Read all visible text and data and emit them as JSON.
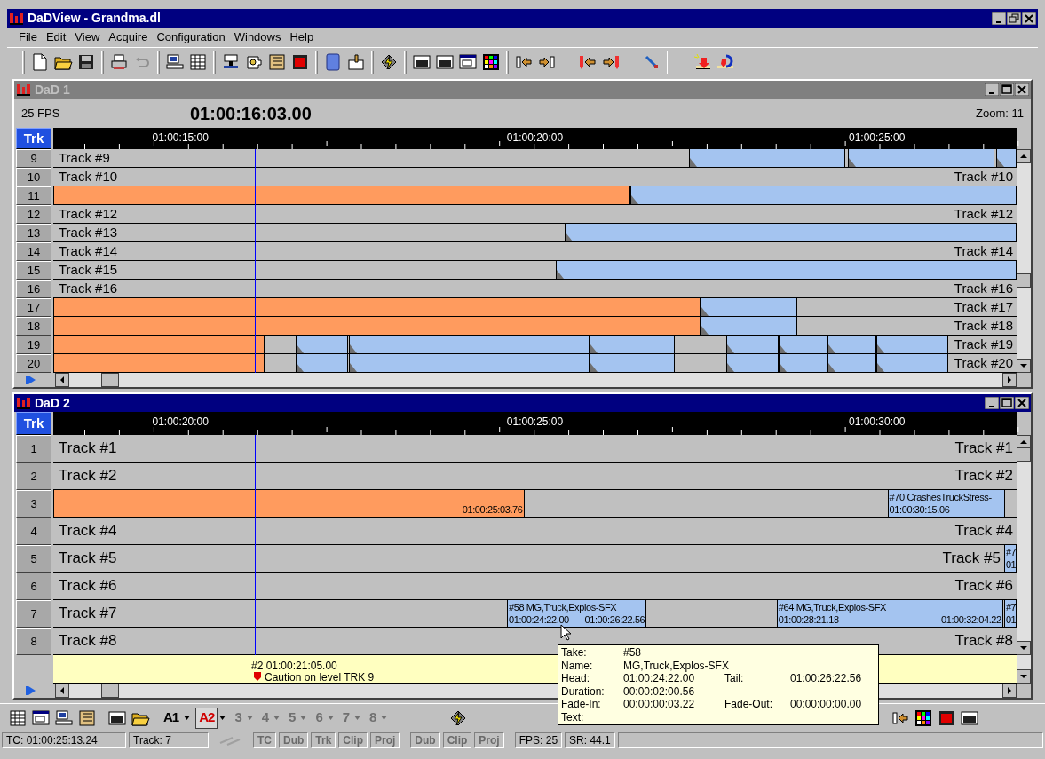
{
  "window": {
    "title": "DaDView - Grandma.dl"
  },
  "menu": [
    "File",
    "Edit",
    "View",
    "Acquire",
    "Configuration",
    "Windows",
    "Help"
  ],
  "panels": [
    {
      "title": "DaD 1",
      "active": false,
      "fps": "25 FPS",
      "timecode": "01:00:16:03.00",
      "zoom": "Zoom: 11",
      "trk": "Trk",
      "ruler": [
        "01:00:15:00",
        "01:00:20:00",
        "01:00:25:00"
      ],
      "tracks": [
        {
          "number": "9",
          "left": "Track #9",
          "clips": [
            {
              "kind": "take"
            },
            {
              "kind": "take"
            },
            {
              "kind": "take"
            }
          ]
        },
        {
          "number": "10",
          "left": "Track #10",
          "right": "Track #10"
        },
        {
          "number": "11",
          "clips": [
            {
              "kind": "region"
            },
            {
              "kind": "take"
            }
          ]
        },
        {
          "number": "12",
          "left": "Track #12",
          "right": "Track #12"
        },
        {
          "number": "13",
          "left": "Track #13",
          "clips": [
            {
              "kind": "take"
            }
          ]
        },
        {
          "number": "14",
          "left": "Track #14",
          "right": "Track #14"
        },
        {
          "number": "15",
          "left": "Track #15",
          "clips": [
            {
              "kind": "take"
            }
          ]
        },
        {
          "number": "16",
          "left": "Track #16",
          "right": "Track #16"
        },
        {
          "number": "17",
          "right": "Track #17",
          "clips": [
            {
              "kind": "region"
            },
            {
              "kind": "take"
            }
          ]
        },
        {
          "number": "18",
          "right": "Track #18",
          "clips": [
            {
              "kind": "region"
            },
            {
              "kind": "take"
            }
          ]
        },
        {
          "number": "19",
          "right": "Track #19",
          "clips": [
            {
              "kind": "region"
            },
            {
              "kind": "take"
            },
            {
              "kind": "take"
            },
            {
              "kind": "take"
            },
            {
              "kind": "take"
            },
            {
              "kind": "take"
            },
            {
              "kind": "take"
            },
            {
              "kind": "take"
            }
          ]
        },
        {
          "number": "20",
          "right": "Track #20",
          "clips": [
            {
              "kind": "region"
            },
            {
              "kind": "take"
            },
            {
              "kind": "take"
            },
            {
              "kind": "take"
            },
            {
              "kind": "take"
            },
            {
              "kind": "take"
            },
            {
              "kind": "take"
            },
            {
              "kind": "take"
            }
          ]
        }
      ]
    },
    {
      "title": "DaD 2",
      "active": true,
      "trk": "Trk",
      "ruler": [
        "01:00:20:00",
        "01:00:25:00",
        "01:00:30:00"
      ],
      "tracks": [
        {
          "number": "1",
          "left": "Track #1",
          "right": "Track #1"
        },
        {
          "number": "2",
          "left": "Track #2",
          "right": "Track #2"
        },
        {
          "number": "3",
          "clips": [
            {
              "kind": "region",
              "tail": "01:00:25:03.76"
            },
            {
              "kind": "take",
              "title": "#70 CrashesTruckStress-",
              "head": "01:00:30:15.06"
            }
          ]
        },
        {
          "number": "4",
          "left": "Track #4",
          "right": "Track #4"
        },
        {
          "number": "5",
          "left": "Track #5",
          "right": "Track #5",
          "clips": [
            {
              "kind": "take",
              "title": "#7",
              "head": "01"
            }
          ]
        },
        {
          "number": "6",
          "left": "Track #6",
          "right": "Track #6"
        },
        {
          "number": "7",
          "left": "Track #7",
          "clips": [
            {
              "kind": "take",
              "title": "#58 MG,Truck,Explos-SFX",
              "head": "01:00:24:22.00",
              "tail": "01:00:26:22.56"
            },
            {
              "kind": "take",
              "title": "#64 MG,Truck,Explos-SFX",
              "head": "01:00:28:21.18",
              "tail": "01:00:32:04.22"
            },
            {
              "kind": "take",
              "title": "#7",
              "head": "01"
            }
          ]
        },
        {
          "number": "8",
          "left": "Track #8",
          "right": "Track #8"
        }
      ],
      "marker": {
        "title": "#2 01:00:21:05.00",
        "note": "Caution on level TRK 9"
      }
    }
  ],
  "tooltip": [
    {
      "label": "Take:",
      "value": "#58"
    },
    {
      "label": "Name:",
      "value": "MG,Truck,Explos-SFX"
    },
    {
      "label": "Head:",
      "value": "01:00:24:22.00",
      "label2": "Tail:",
      "value2": "01:00:26:22.56"
    },
    {
      "label": "Duration:",
      "value": "00:00:02:00.56"
    },
    {
      "label": "Fade-In:",
      "value": "00:00:00:03.22",
      "label2": "Fade-Out:",
      "value2": "00:00:00:00.00"
    },
    {
      "label": "Text:"
    }
  ],
  "layer_buttons": [
    {
      "label": "A1",
      "selected": false,
      "disabled": false
    },
    {
      "label": "A2",
      "selected": true,
      "disabled": false
    },
    {
      "label": "3",
      "selected": false,
      "disabled": true
    },
    {
      "label": "4",
      "selected": false,
      "disabled": true
    },
    {
      "label": "5",
      "selected": false,
      "disabled": true
    },
    {
      "label": "6",
      "selected": false,
      "disabled": true
    },
    {
      "label": "7",
      "selected": false,
      "disabled": true
    },
    {
      "label": "8",
      "selected": false,
      "disabled": true
    }
  ],
  "status_bar": [
    {
      "text": "TC: 01:00:25:13.24",
      "disabled": false
    },
    {
      "text": "Track: 7",
      "disabled": false
    },
    {
      "text": "TC",
      "disabled": true
    },
    {
      "text": "Dub",
      "disabled": true
    },
    {
      "text": "Trk",
      "disabled": true
    },
    {
      "text": "Clip",
      "disabled": true
    },
    {
      "text": "Proj",
      "disabled": true
    },
    {
      "text": "Dub",
      "disabled": true
    },
    {
      "text": "Clip",
      "disabled": true
    },
    {
      "text": "Proj",
      "disabled": true
    },
    {
      "text": "FPS: 25",
      "disabled": false
    },
    {
      "text": "SR: 44.1",
      "disabled": false
    }
  ]
}
